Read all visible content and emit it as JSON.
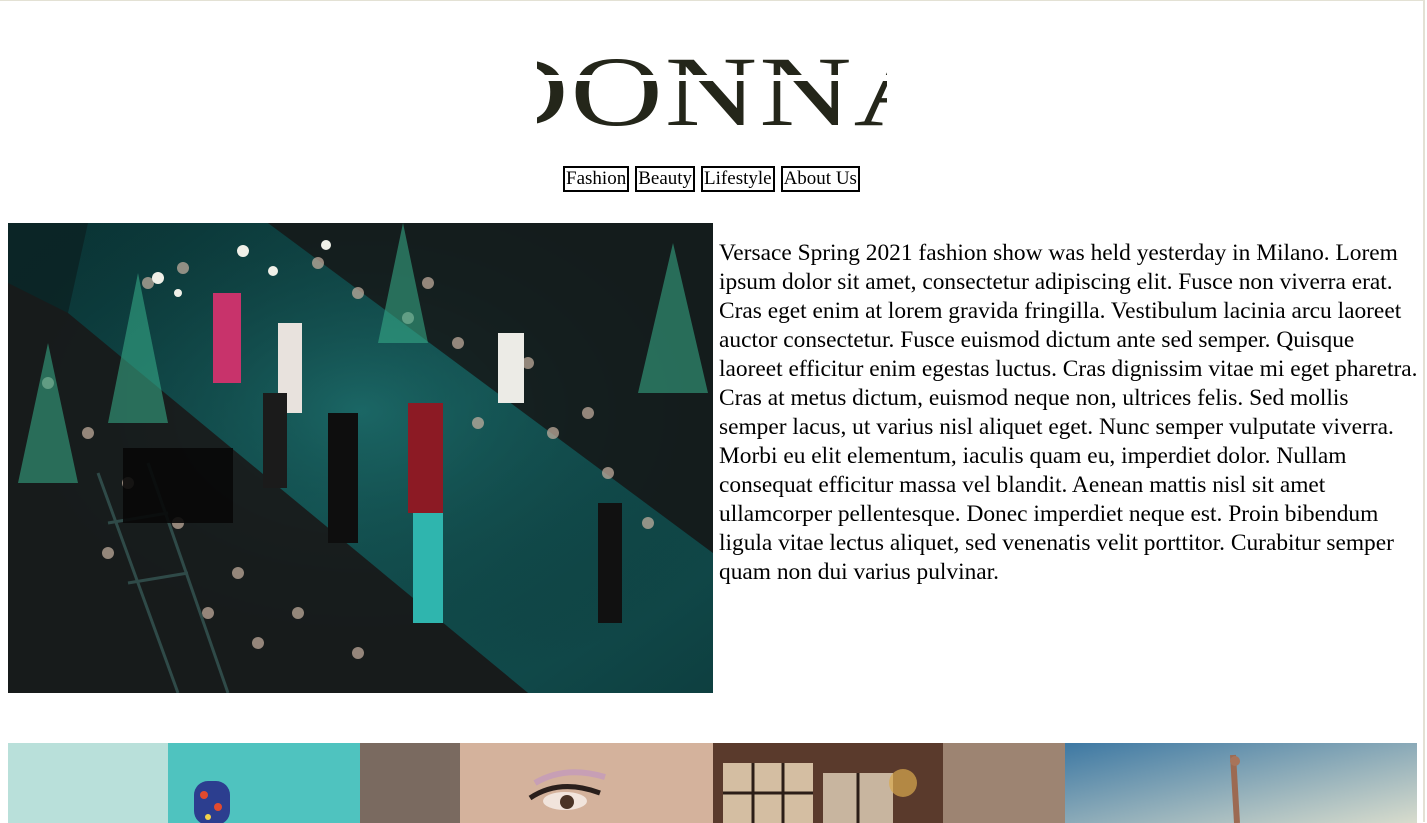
{
  "brand": {
    "logo_text": "DONNA",
    "logo_color": "#24261a"
  },
  "nav": {
    "items": [
      {
        "label": "Fashion"
      },
      {
        "label": "Beauty"
      },
      {
        "label": "Lifestyle"
      },
      {
        "label": "About Us"
      }
    ]
  },
  "hero": {
    "image_icon": "runway-photo",
    "text": "Versace Spring 2021 fashion show was held yesterday in Milano. Lorem ipsum dolor sit amet, consectetur adipiscing elit. Fusce non viverra erat. Cras eget enim at lorem gravida fringilla. Vestibulum lacinia arcu laoreet auctor consectetur. Fusce euismod dictum ante sed semper. Quisque laoreet efficitur enim egestas luctus. Cras dignissim vitae mi eget pharetra. Cras at metus dictum, euismod neque non, ultrices felis. Sed mollis semper lacus, ut varius nisl aliquet eget. Nunc semper vulputate viverra. Morbi eu elit elementum, iaculis quam eu, imperdiet dolor. Nullam consequat efficitur massa vel blandit. Aenean mattis nisl sit amet ullamcorper pellentesque. Donec imperdiet neque est. Proin bibendum ligula vitae lectus aliquet, sed venenatis velit porttitor. Curabitur semper quam non dui varius pulvinar."
  },
  "thumbnails": [
    {
      "icon": "fashion-photo"
    },
    {
      "icon": "beauty-photo"
    },
    {
      "icon": "lifestyle-photo"
    },
    {
      "icon": "beach-photo"
    }
  ],
  "colors": {
    "background": "#ffffff",
    "border": "#e3e1d4",
    "runway_teal": "#0f4c4d"
  }
}
